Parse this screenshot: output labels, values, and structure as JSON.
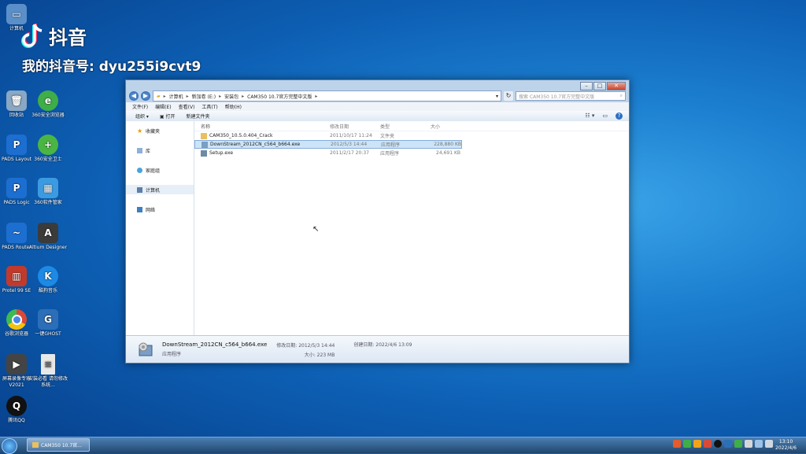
{
  "watermark": {
    "brand": "抖音",
    "account": "我的抖音号: dyu255i9cvt9"
  },
  "desktop_icons": [
    {
      "label": "计算机",
      "color": "#5b8fc9"
    },
    {
      "label": "回收站",
      "color": "#8aa7c4"
    },
    {
      "label": "360安全浏览器",
      "color": "#3fae49"
    },
    {
      "label": "PADS Layout",
      "color": "#1c6fd1"
    },
    {
      "label": "360安全卫士",
      "color": "#4bb543"
    },
    {
      "label": "PADS Logic",
      "color": "#1c6fd1"
    },
    {
      "label": "360软件管家",
      "color": "#3c9be0"
    },
    {
      "label": "PADS Router",
      "color": "#1c6fd1"
    },
    {
      "label": "Altium Designer",
      "color": "#3b3b3b"
    },
    {
      "label": "Protel 99 SE",
      "color": "#c23a2b"
    },
    {
      "label": "酷狗音乐",
      "color": "#1d8ae5"
    },
    {
      "label": "谷歌浏览器",
      "color": "#d84a38"
    },
    {
      "label": "一键GHOST",
      "color": "#2c6fb8"
    },
    {
      "label": "屏幕录像专家 V2021",
      "color": "#444444"
    },
    {
      "label": "安装必看 请勿修改系统...",
      "color": "#e8e8e8"
    },
    {
      "label": "腾讯QQ",
      "color": "#111111"
    }
  ],
  "window": {
    "address": [
      "计算机",
      "新加卷 (E:)",
      "安装包",
      "CAM350 10.7官方完整中文版"
    ],
    "search_placeholder": "搜索 CAM350 10.7官方完整中文版",
    "menu": [
      "文件(F)",
      "编辑(E)",
      "查看(V)",
      "工具(T)",
      "帮助(H)"
    ],
    "toolbar": [
      "组织 ▾",
      "打开",
      "新建文件夹"
    ],
    "sidebar": [
      {
        "label": "收藏夹",
        "selected": false
      },
      {
        "label": "库",
        "selected": false
      },
      {
        "label": "家庭组",
        "selected": false
      },
      {
        "label": "计算机",
        "selected": true
      },
      {
        "label": "网络",
        "selected": false
      }
    ],
    "columns": [
      "名称",
      "修改日期",
      "类型",
      "大小"
    ],
    "files": [
      {
        "name": "CAM350_10.5.0.404_Crack",
        "date": "2011/10/17 11:24",
        "type": "文件夹",
        "size": "",
        "icon": "folder"
      },
      {
        "name": "DownStream_2012CN_c564_b664.exe",
        "date": "2012/5/3 14:44",
        "type": "应用程序",
        "size": "228,880 KB",
        "icon": "exe",
        "selected": true
      },
      {
        "name": "Setup.exe",
        "date": "2011/2/17 20:37",
        "type": "应用程序",
        "size": "24,691 KB",
        "icon": "exe"
      }
    ],
    "details": {
      "name": "DownStream_2012CN_c564_b664.exe",
      "kind": "应用程序",
      "modified_label": "修改日期: 2012/5/3 14:44",
      "size_label": "大小: 223 MB",
      "created_label": "创建日期: 2022/4/6 13:09"
    }
  },
  "taskbar": {
    "item": "CAM350 10.7官...",
    "time": "13:10",
    "date": "2022/4/6"
  }
}
